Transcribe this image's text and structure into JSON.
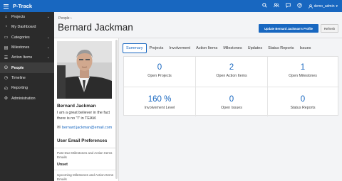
{
  "app": {
    "title": "P-Track"
  },
  "header": {
    "icons": [
      "search-icon",
      "people-icon",
      "chat-icon",
      "help-icon"
    ],
    "user_name": "demo_admin"
  },
  "sidebar": {
    "items": [
      {
        "label": "Projects",
        "icon": "home-icon",
        "expandable": true
      },
      {
        "label": "My Dashboard",
        "icon": "dashboard-icon",
        "expandable": false
      },
      {
        "label": "Categories",
        "icon": "folder-icon",
        "expandable": true
      },
      {
        "label": "Milestones",
        "icon": "milestone-icon",
        "expandable": true
      },
      {
        "label": "Action Items",
        "icon": "checklist-icon",
        "expandable": true
      },
      {
        "label": "People",
        "icon": "people-icon",
        "expandable": false,
        "active": true
      },
      {
        "label": "Timeline",
        "icon": "clock-icon",
        "expandable": false
      },
      {
        "label": "Reporting",
        "icon": "chart-icon",
        "expandable": false
      },
      {
        "label": "Administration",
        "icon": "gear-icon",
        "expandable": false
      }
    ]
  },
  "page": {
    "breadcrumb": "People",
    "title": "Bernard Jackman",
    "update_button": "Update Bernard Jackman's Profile",
    "refresh_button": "Refresh"
  },
  "profile": {
    "name": "Bernard Jackman",
    "bio": "I am a great believer in the fact there is no \"I\" in TEAM.",
    "email": "bernard.jackman@email.com",
    "preferences_title": "User Email Preferences",
    "preferences": [
      {
        "label": "Past Due Milestones and Action Items Emails",
        "value": "Unset"
      },
      {
        "label": "Upcoming Milestones and Action Items Emails",
        "value": ""
      }
    ]
  },
  "tabs": [
    "Summary",
    "Projects",
    "Involvement",
    "Action Items",
    "Milestones",
    "Updates",
    "Status Reports",
    "Issues"
  ],
  "active_tab": "Summary",
  "stats": [
    {
      "value": "0",
      "label": "Open Projects"
    },
    {
      "value": "2",
      "label": "Open Action Items"
    },
    {
      "value": "1",
      "label": "Open Milestones"
    },
    {
      "value": "160 %",
      "label": "Involvement Level"
    },
    {
      "value": "0",
      "label": "Open Issues"
    },
    {
      "value": "0",
      "label": "Status Reports"
    }
  ],
  "colors": {
    "brand": "#1867c0",
    "sidebar": "#2b2b2b"
  }
}
